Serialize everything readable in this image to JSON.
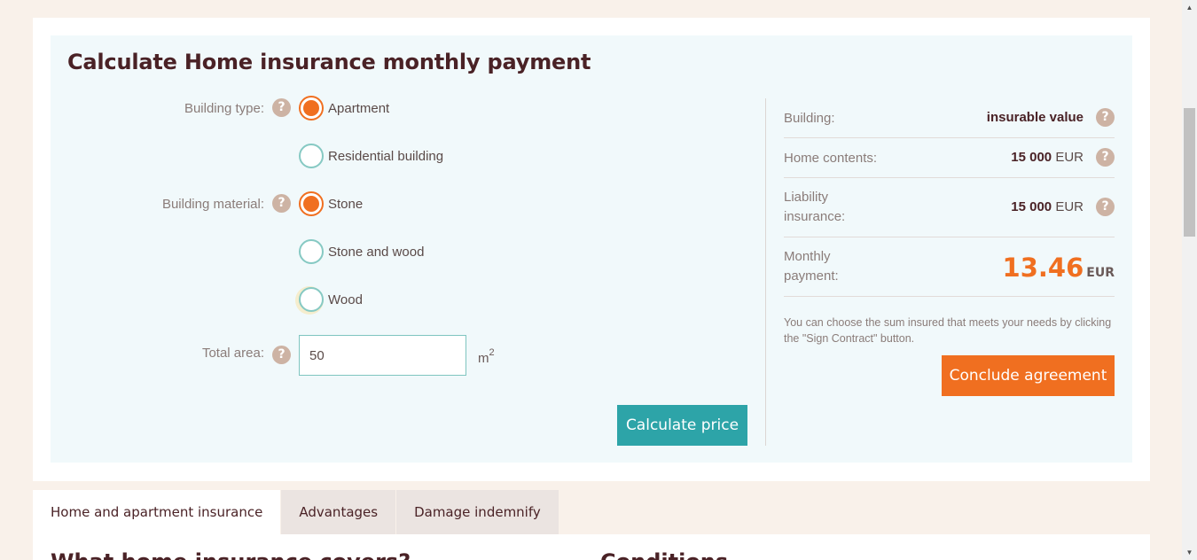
{
  "calculator": {
    "title": "Calculate Home insurance monthly payment",
    "building_type": {
      "label": "Building type:",
      "options": [
        {
          "label": "Apartment",
          "checked": true
        },
        {
          "label": "Residential building",
          "checked": false
        }
      ]
    },
    "building_material": {
      "label": "Building material:",
      "options": [
        {
          "label": "Stone",
          "checked": true
        },
        {
          "label": "Stone and wood",
          "checked": false
        },
        {
          "label": "Wood",
          "checked": false
        }
      ]
    },
    "total_area": {
      "label": "Total area:",
      "value": "50",
      "unit": "m",
      "unit_sup": "2"
    },
    "calculate_button": "Calculate price",
    "help_glyph": "?"
  },
  "summary": {
    "building": {
      "label": "Building:",
      "value": "insurable value"
    },
    "home_contents": {
      "label": "Home contents:",
      "amount": "15 000",
      "currency": "EUR"
    },
    "liability": {
      "label": "Liability insurance:",
      "amount": "15 000",
      "currency": "EUR"
    },
    "monthly": {
      "label": "Monthly payment:",
      "amount": "13.46",
      "currency": "EUR"
    },
    "note": "You can choose the sum insured that meets your needs by clicking the \"Sign Contract\" button.",
    "conclude_button": "Conclude agreement"
  },
  "tabs": [
    {
      "label": "Home and apartment insurance",
      "active": true
    },
    {
      "label": "Advantages",
      "active": false
    },
    {
      "label": "Damage indemnify",
      "active": false
    }
  ],
  "panel": {
    "left_heading": "What home insurance covers?",
    "right_heading": "Conditions"
  },
  "colors": {
    "accent": "#f06f20",
    "teal": "#2da4a8",
    "title": "#4a2226",
    "help": "#cdb3a4"
  }
}
